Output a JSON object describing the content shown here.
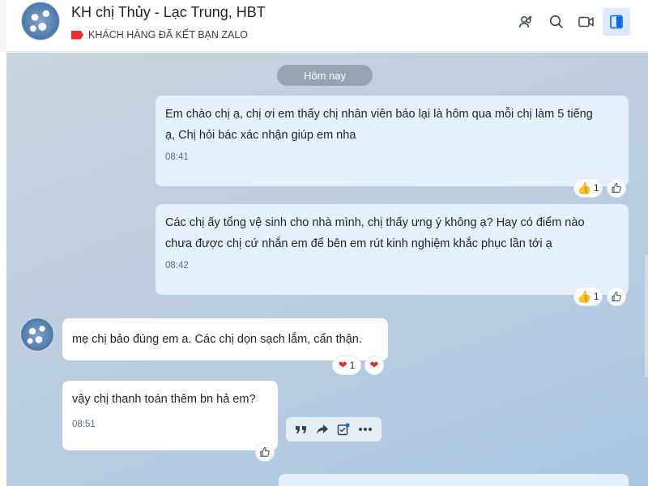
{
  "header": {
    "title": "KH chị Thủy - Lạc Trung, HBT",
    "subtitle": "KHÁCH HÀNG ĐÃ KẾT BẠN ZALO",
    "icons": [
      "add-member-icon",
      "search-icon",
      "video-call-icon",
      "panel-toggle-icon"
    ]
  },
  "chat": {
    "day_label": "Hôm nay",
    "messages": [
      {
        "direction": "out",
        "lines": [
          "Em chào chị ạ, chị ơi em thấy chị nhân viên báo lại là hôm qua mỗi chị làm 5 tiếng",
          "ạ, Chị hỏi bác xác nhận giúp em nha"
        ],
        "time": "08:41",
        "reaction": {
          "emoji": "like",
          "count": "1"
        }
      },
      {
        "direction": "out",
        "lines": [
          "Các chị ấy tổng vệ sinh cho nhà mình, chị thấy ưng ý không ạ? Hay có điểm nào",
          "chưa được chị cứ nhắn em để bên em rút kinh nghiệm khắc phục lần tới ạ"
        ],
        "time": "08:42",
        "reaction": {
          "emoji": "like",
          "count": "1"
        }
      },
      {
        "direction": "in",
        "lines": [
          "mẹ chị bảo đúng em a. Các chị dọn sạch lắm, cẩn thận."
        ],
        "time": "",
        "reaction": {
          "emoji": "heart",
          "count": "1"
        }
      },
      {
        "direction": "in",
        "lines": [
          "vậy chị thanh toán thêm bn hả em?"
        ],
        "time": "08:51",
        "reaction": null
      }
    ]
  },
  "colors": {
    "accent": "#0068ff",
    "tag_red": "#e5312b",
    "bubble_out": "#e6f0fd",
    "bubble_in": "#ffffff"
  }
}
